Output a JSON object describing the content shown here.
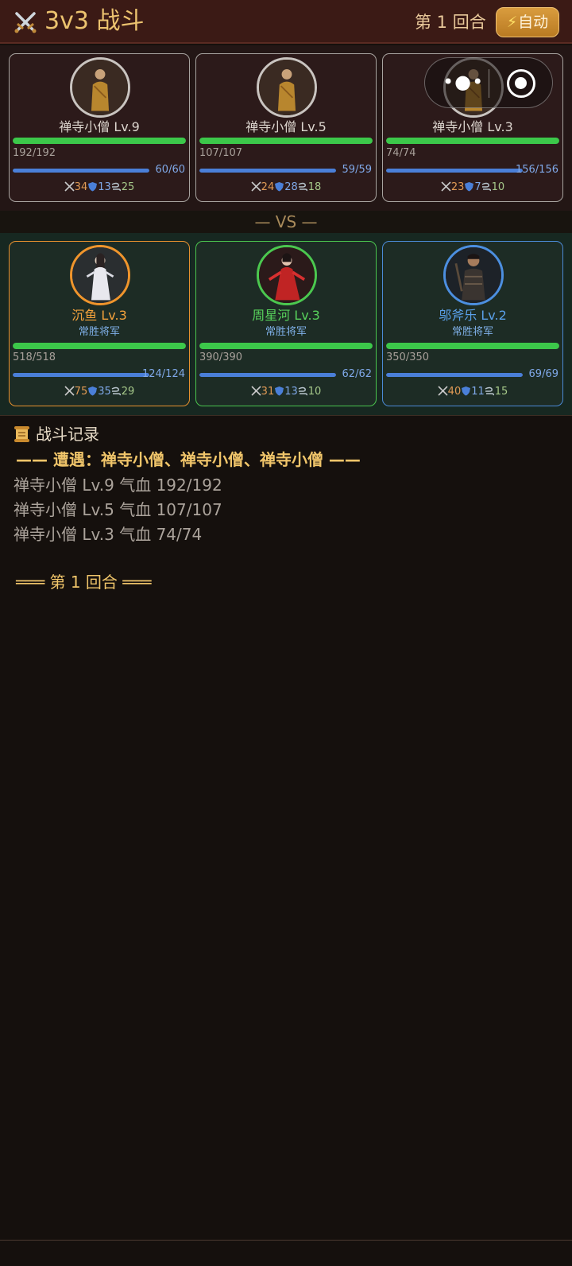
{
  "header": {
    "title": "3v3 战斗",
    "round_label": "第 1 回合",
    "auto_button": "自动"
  },
  "vs_label": "— VS —",
  "enemies": [
    {
      "name": "禅寺小僧 Lv.9",
      "hp_text": "192/192",
      "hp_fraction": 1.0,
      "mp_text": "60/60",
      "mp_fraction": 1.0,
      "atk": "34",
      "def": "13",
      "spd": "25"
    },
    {
      "name": "禅寺小僧 Lv.5",
      "hp_text": "107/107",
      "hp_fraction": 1.0,
      "mp_text": "59/59",
      "mp_fraction": 1.0,
      "atk": "24",
      "def": "28",
      "spd": "18"
    },
    {
      "name": "禅寺小僧 Lv.3",
      "hp_text": "74/74",
      "hp_fraction": 1.0,
      "mp_text": "156/156",
      "mp_fraction": 1.0,
      "atk": "23",
      "def": "7",
      "spd": "10"
    }
  ],
  "allies": [
    {
      "name": "沉鱼 Lv.3",
      "subtitle": "常胜将军",
      "hp_text": "518/518",
      "hp_fraction": 1.0,
      "mp_text": "124/124",
      "mp_fraction": 1.0,
      "atk": "75",
      "def": "35",
      "spd": "29",
      "accent": "#e7912f"
    },
    {
      "name": "周星河 Lv.3",
      "subtitle": "常胜将军",
      "hp_text": "390/390",
      "hp_fraction": 1.0,
      "mp_text": "62/62",
      "mp_fraction": 1.0,
      "atk": "31",
      "def": "13",
      "spd": "10",
      "accent": "#4ac44e"
    },
    {
      "name": "邬斧乐 Lv.2",
      "subtitle": "常胜将军",
      "hp_text": "350/350",
      "hp_fraction": 1.0,
      "mp_text": "69/69",
      "mp_fraction": 1.0,
      "atk": "40",
      "def": "11",
      "spd": "15",
      "accent": "#4b8ad6"
    }
  ],
  "log": {
    "title": "战斗记录",
    "encounter": "—— 遭遇：禅寺小僧、禅寺小僧、禅寺小僧 ——",
    "lines": [
      "禅寺小僧 Lv.9 气血 192/192",
      "禅寺小僧 Lv.5 气血 107/107",
      "禅寺小僧 Lv.3 气血 74/74"
    ],
    "round_marker": "═══ 第 1 回合 ═══"
  },
  "icons": {
    "title": "crossed-swords-icon",
    "auto": "lightning-icon",
    "attack": "sword-icon",
    "defense": "shield-icon",
    "speed": "wind-icon",
    "log": "scroll-icon",
    "capsule_more": "more-dots-icon",
    "capsule_close": "target-circle-icon"
  },
  "colors": {
    "hp": "#3cc84a",
    "mp": "#4a7fd8",
    "gold": "#ecc36f"
  }
}
